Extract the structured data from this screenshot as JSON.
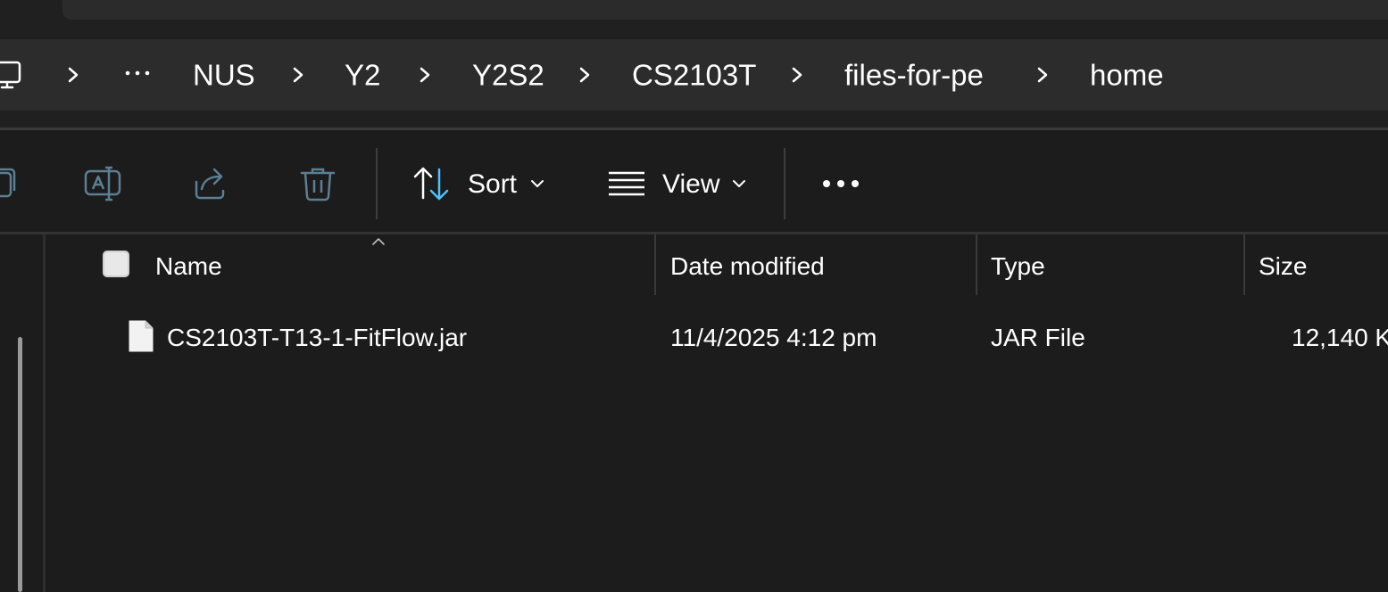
{
  "breadcrumb": {
    "items": [
      "NUS",
      "Y2",
      "Y2S2",
      "CS2103T",
      "files-for-pe",
      "home"
    ]
  },
  "toolbar": {
    "sort_label": "Sort",
    "view_label": "View"
  },
  "columns": {
    "name": "Name",
    "date_modified": "Date modified",
    "type": "Type",
    "size": "Size"
  },
  "files": [
    {
      "name": "CS2103T-T13-1-FitFlow.jar",
      "date_modified": "11/4/2025 4:12 pm",
      "type": "JAR File",
      "size": "12,140 K"
    }
  ],
  "icons": {
    "pc": "this-pc-icon",
    "copy": "copy-icon",
    "rename": "rename-icon",
    "share": "share-icon",
    "delete": "delete-icon",
    "sort": "sort-arrows-icon",
    "view": "view-lines-icon",
    "more": "more-options-icon",
    "file": "file-icon"
  },
  "colors": {
    "background": "#1c1c1c",
    "address_bar": "#2c2c2c",
    "accent_blue": "#4cc2ff",
    "disabled_icon": "#5b7f94"
  }
}
